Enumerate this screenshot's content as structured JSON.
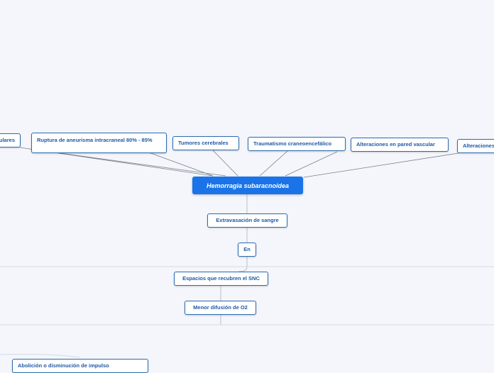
{
  "root": {
    "label": "Hemorragia subaracnoidea"
  },
  "causes": [
    {
      "label": "Alteraciones vasculares"
    },
    {
      "label": "Ruptura de aneurisma intracraneal 80% - 85%"
    },
    {
      "label": "Tumores cerebrales"
    },
    {
      "label": "Traumatismo craneoencefálico"
    },
    {
      "label": "Alteraciones en pared vascular"
    },
    {
      "label": "Alteraciones"
    }
  ],
  "chain": [
    {
      "label": "Extravasación de sangre"
    },
    {
      "label": "En"
    },
    {
      "label": "Espacios que recubren el SNC"
    },
    {
      "label": "Menor difusión de O2"
    },
    {
      "label": "Abolición o disminución de impulso"
    }
  ],
  "colors": {
    "background": "#f4f6fc",
    "root_fill": "#1a73e8",
    "node_border": "#2b6cb0",
    "node_text": "#1f5aa6",
    "connector": "#7a8089"
  }
}
